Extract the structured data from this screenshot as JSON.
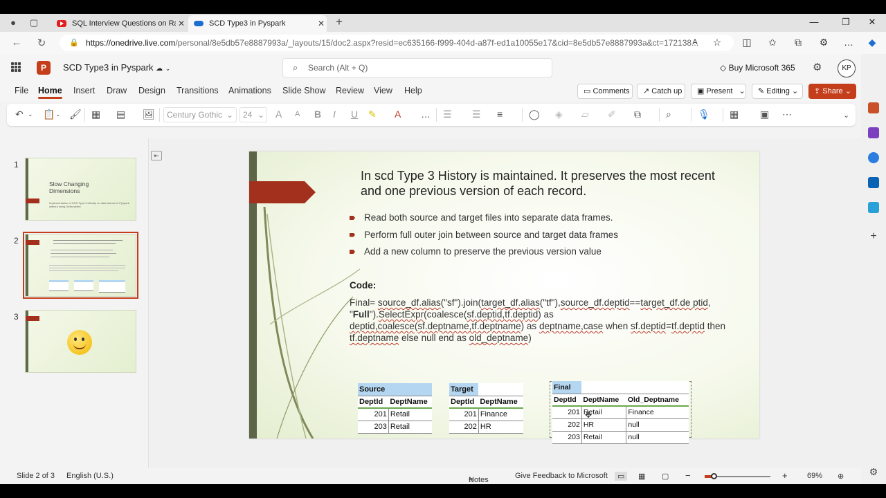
{
  "browser": {
    "tabs": [
      {
        "label": "SQL Interview Questions on Rank",
        "icon": "youtube-icon"
      },
      {
        "label": "SCD Type3 in Pyspark",
        "icon": "onedrive-icon"
      }
    ],
    "url_host": "https://onedrive.live.com",
    "url_rest": "/personal/8e5db57e8887993a/_layouts/15/doc2.aspx?resid=ec635166-f999-404d-a87f-ed1a10055e17&cid=8e5db57e8887993a&ct=172138..."
  },
  "office": {
    "doc_title": "SCD Type3 in Pyspark",
    "search_placeholder": "Search (Alt + Q)",
    "buy": "Buy Microsoft 365",
    "avatar": "KP"
  },
  "menu": {
    "items": [
      "File",
      "Home",
      "Insert",
      "Draw",
      "Design",
      "Transitions",
      "Animations",
      "Slide Show",
      "Review",
      "View",
      "Help"
    ],
    "active": "Home",
    "comments": "Comments",
    "catchup": "Catch up",
    "present": "Present",
    "editing": "Editing",
    "share": "Share"
  },
  "ribbon": {
    "font": "Century Gothic",
    "size": "24"
  },
  "thumbnails": [
    {
      "num": "1",
      "title": "Slow Changing Dimensions",
      "sub": "Implementation of SCD Type 3 directly on data frames in Pyspark without using Delta tables"
    },
    {
      "num": "2"
    },
    {
      "num": "3"
    }
  ],
  "slide": {
    "title": "In scd Type 3 History is maintained. It preserves the most recent and one previous version of each record.",
    "bullets": [
      "Read both source and target files into separate data frames.",
      "Perform full outer join between source and target data frames",
      "Add a new column to preserve the previous version value"
    ],
    "code_heading": "Code:",
    "code": {
      "p1": "Final= ",
      "p2": "source_df.alias",
      "p3": "(\"sf\").join(",
      "p4": "target_df.alias",
      "p5": "(\"tf\"),",
      "p6": "source_df.deptid",
      "p7": "==",
      "p8": "target_df.de ptid",
      "p9": ", \"",
      "p10": "Full",
      "p11": "\").",
      "p12": "SelectExpr",
      "p13": "(coalesce(",
      "p14": "sf.deptid,tf.deptid",
      "p15": ") as ",
      "p16": "deptid,coalesce",
      "p17": "(",
      "p18": "sf.deptname,tf.deptname",
      "p19": ") as ",
      "p20": "deptname,case",
      "p21": " when ",
      "p22": "sf.deptid",
      "p23": "=",
      "p24": "tf.deptid",
      "p25": " then ",
      "p26": "tf.deptname",
      "p27": " else null end as ",
      "p28": "old_deptname",
      "p29": ")"
    },
    "source_table": {
      "caption": "Source",
      "headers": [
        "DeptId",
        "DeptName"
      ],
      "rows": [
        [
          "201",
          "Retail"
        ],
        [
          "203",
          "Retail"
        ]
      ]
    },
    "target_table": {
      "caption": "Target",
      "headers": [
        "DeptId",
        "DeptName"
      ],
      "rows": [
        [
          "201",
          "Finance"
        ],
        [
          "202",
          "HR"
        ]
      ]
    },
    "final_table": {
      "caption": "Final",
      "headers": [
        "DeptId",
        "DeptName",
        "Old_Deptname"
      ],
      "rows": [
        [
          "201",
          "Retail",
          "Finance"
        ],
        [
          "202",
          "HR",
          "null"
        ],
        [
          "203",
          "Retail",
          "null"
        ]
      ]
    }
  },
  "status": {
    "slide": "Slide 2 of 3",
    "lang": "English (U.S.)",
    "notes": "Notes",
    "feedback": "Give Feedback to Microsoft",
    "zoom": "69%",
    "zoom_fraction": 0.16
  }
}
